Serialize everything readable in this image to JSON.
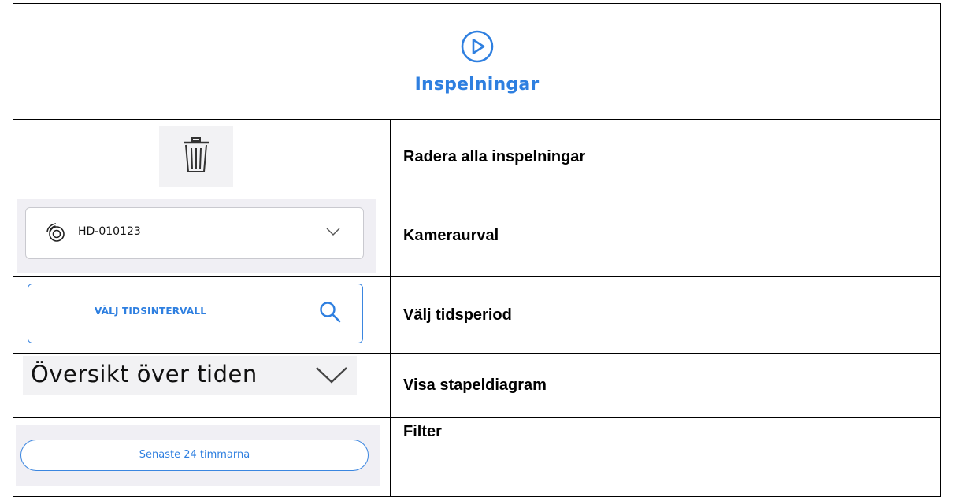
{
  "header": {
    "icon": "play-circle-icon",
    "title": "Inspelningar"
  },
  "rows": [
    {
      "icon": "trash-icon",
      "description": "Radera alla inspelningar"
    },
    {
      "camera_icon": "camera-icon",
      "camera_name": "HD-010123",
      "chevron_icon": "chevron-down-icon",
      "description": "Kameraurval"
    },
    {
      "button_label": "VÄLJ TIDSINTERVALL",
      "search_icon": "search-icon",
      "description": "Välj tidsperiod"
    },
    {
      "label": "Översikt över tiden",
      "chevron_icon": "chevron-down-icon",
      "description": "Visa stapeldiagram"
    },
    {
      "filter_label": "Senaste 24 timmarna",
      "description": "Filter"
    }
  ],
  "colors": {
    "accent": "#2e7fe0",
    "panel_bg": "#f0eff4",
    "border": "#000000"
  }
}
